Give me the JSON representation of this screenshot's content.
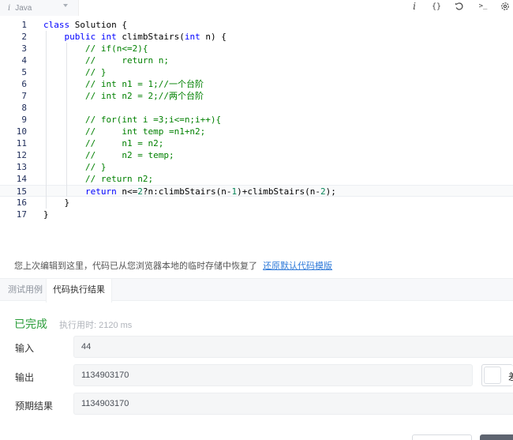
{
  "toolbar": {
    "language": "Java",
    "info_icon": "info-icon",
    "format_icon": "braces-icon",
    "reset_icon": "undo-icon",
    "console_icon": "terminal-icon",
    "settings_icon": "gear-icon",
    "format_glyph": "{}",
    "console_glyph": ">_",
    "info_glyph": "i"
  },
  "editor": {
    "active_line": 15,
    "lines": [
      {
        "n": "1",
        "text": "class Solution {"
      },
      {
        "n": "2",
        "text": "    public int climbStairs(int n) {"
      },
      {
        "n": "3",
        "text": "        // if(n<=2){"
      },
      {
        "n": "4",
        "text": "        //     return n;"
      },
      {
        "n": "5",
        "text": "        // }"
      },
      {
        "n": "6",
        "text": "        // int n1 = 1;//一个台阶"
      },
      {
        "n": "7",
        "text": "        // int n2 = 2;//两个台阶"
      },
      {
        "n": "8",
        "text": ""
      },
      {
        "n": "9",
        "text": "        // for(int i =3;i<=n;i++){"
      },
      {
        "n": "10",
        "text": "        //     int temp =n1+n2;"
      },
      {
        "n": "11",
        "text": "        //     n1 = n2;"
      },
      {
        "n": "12",
        "text": "        //     n2 = temp;"
      },
      {
        "n": "13",
        "text": "        // }"
      },
      {
        "n": "14",
        "text": "        // return n2;"
      },
      {
        "n": "15",
        "text": "        return n<=2?n:climbStairs(n-1)+climbStairs(n-2);"
      },
      {
        "n": "16",
        "text": "    }"
      },
      {
        "n": "17",
        "text": "}"
      }
    ]
  },
  "notice": {
    "text": "您上次编辑到这里，代码已从您浏览器本地的临时存储中恢复了",
    "link": "还原默认代码模版"
  },
  "tabs": [
    {
      "label": "测试用例",
      "active": false
    },
    {
      "label": "代码执行结果",
      "active": true
    }
  ],
  "result": {
    "status": "已完成",
    "runtime": "执行用时: 2120 ms",
    "input_label": "输入",
    "input_value": "44",
    "output_label": "输出",
    "output_value": "1134903170",
    "expected_label": "预期结果",
    "expected_value": "1134903170",
    "side_button_partial": "差"
  },
  "colors": {
    "keyword": "#0000ff",
    "comment": "#008000",
    "number": "#098658",
    "success": "#2a9d3a",
    "link": "#2f7ad9"
  }
}
